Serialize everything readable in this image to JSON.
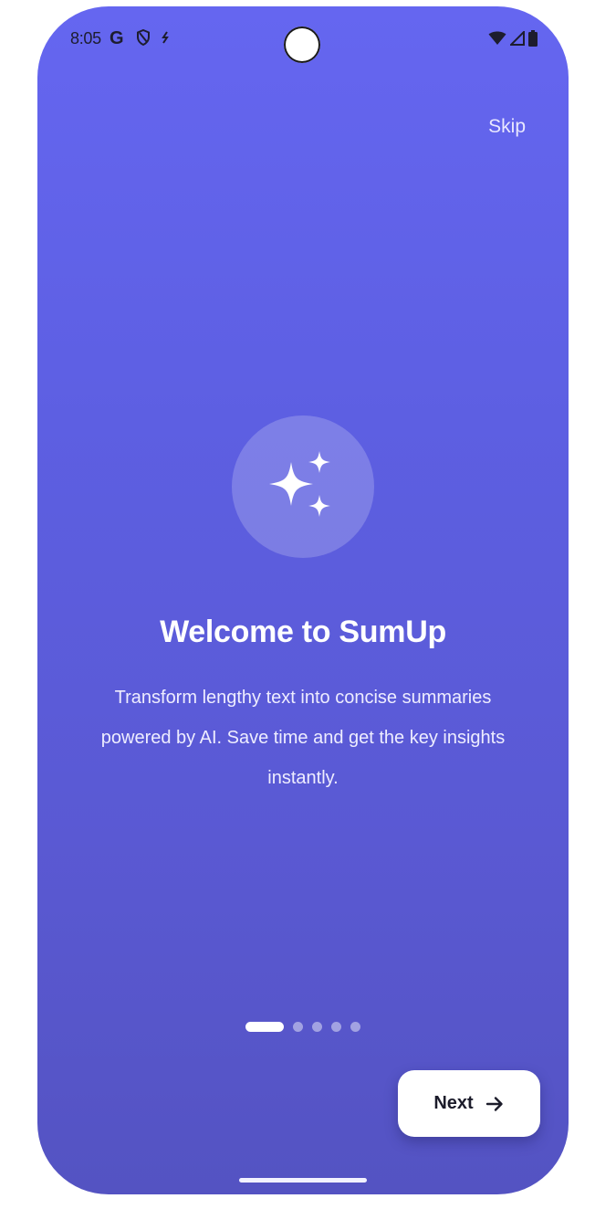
{
  "status_bar": {
    "time": "8:05",
    "left_icons": [
      "google-icon",
      "shield-icon",
      "sync-icon"
    ],
    "right_icons": [
      "wifi-icon",
      "signal-icon",
      "battery-icon"
    ]
  },
  "onboarding": {
    "skip_label": "Skip",
    "hero_icon": "sparkles-icon",
    "title": "Welcome to SumUp",
    "description": "Transform lengthy text into concise summaries powered by AI. Save time and get the key insights instantly.",
    "pages_total": 5,
    "current_page": 1,
    "next_label": "Next"
  },
  "colors": {
    "gradient_top": "#6566F0",
    "gradient_bottom": "#5453C2",
    "button_bg": "#FFFFFF",
    "button_text": "#1B1B2A"
  }
}
